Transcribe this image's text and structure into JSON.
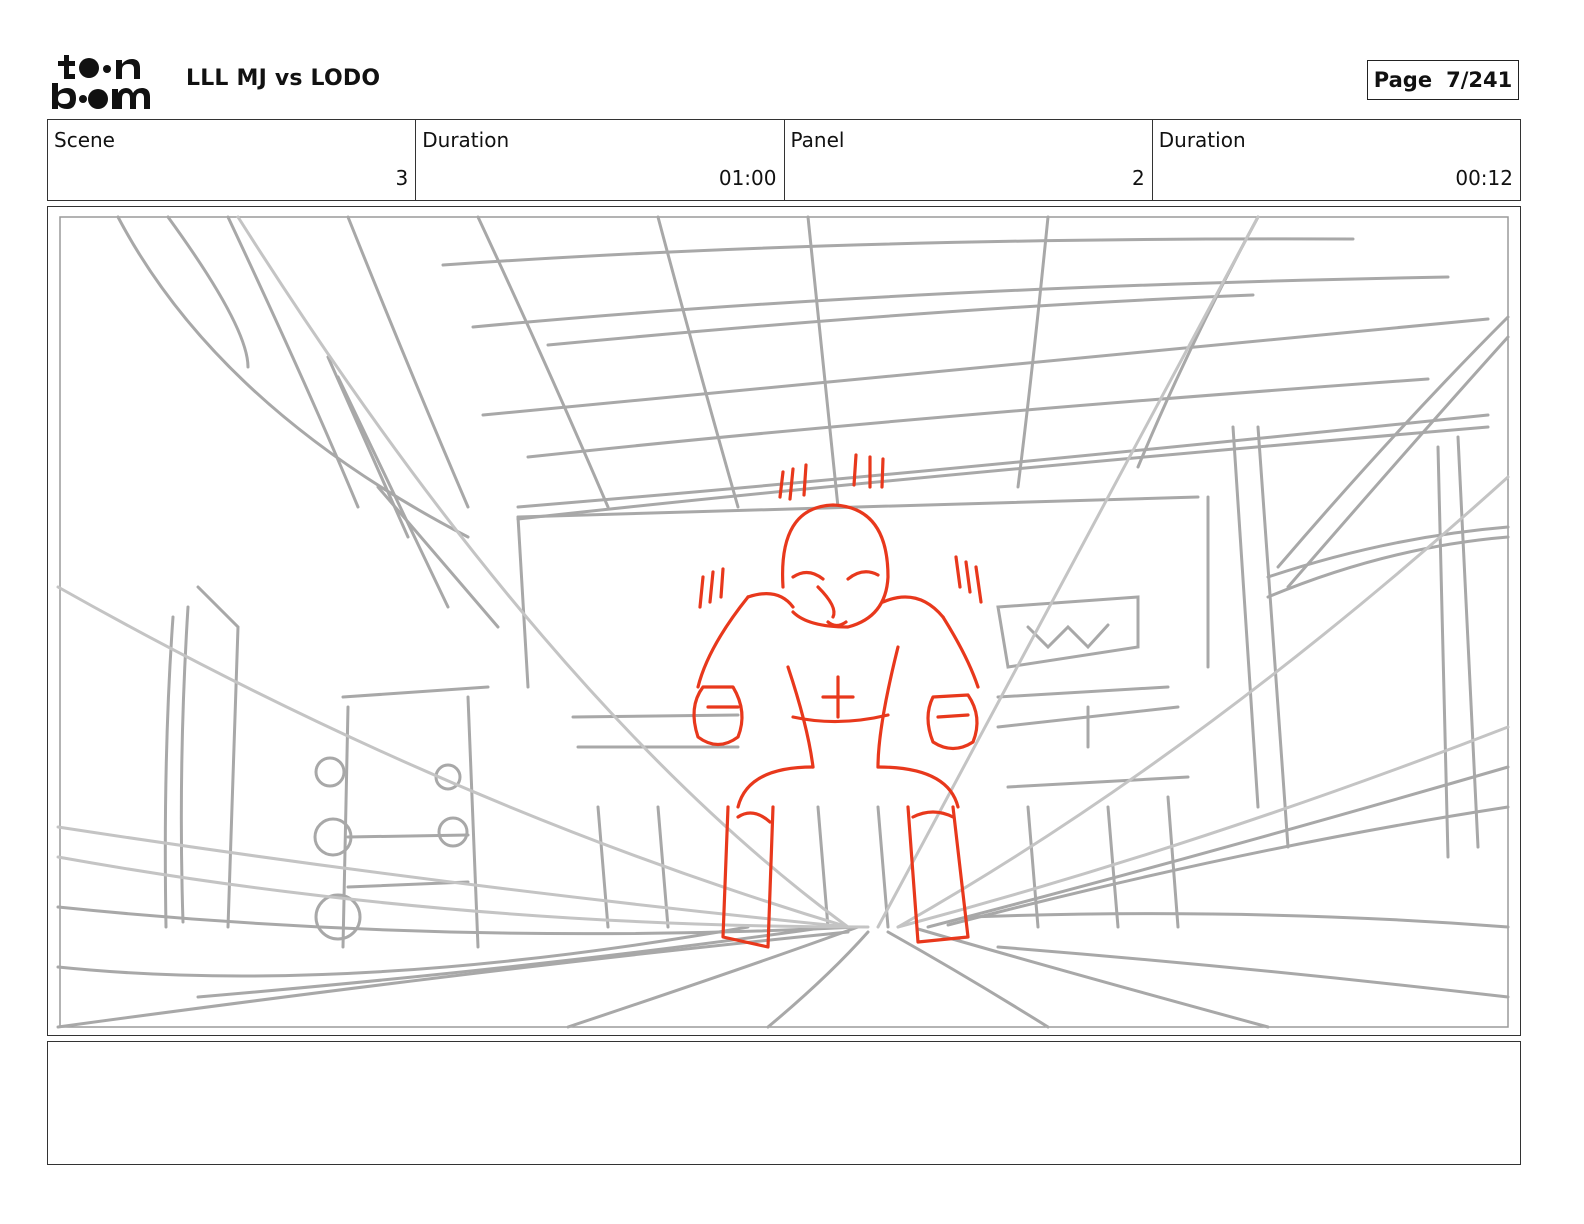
{
  "header": {
    "logo_text_top": "toon",
    "logo_text_bottom": "boom",
    "project_title": "LLL MJ vs LODO",
    "page_label": "Page",
    "page_value": "7/241"
  },
  "info": {
    "scene_label": "Scene",
    "scene_value": "3",
    "scene_duration_label": "Duration",
    "scene_duration_value": "01:00",
    "panel_label": "Panel",
    "panel_value": "2",
    "panel_duration_label": "Duration",
    "panel_duration_value": "00:12"
  },
  "colors": {
    "sketch_gray": "#a8a8a8",
    "character_red": "#e8381c",
    "border": "#333333"
  },
  "notes": {
    "text": ""
  }
}
